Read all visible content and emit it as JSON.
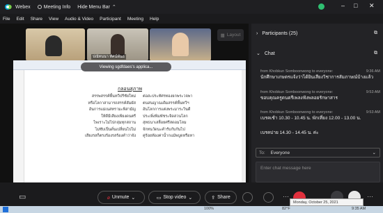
{
  "window": {
    "app_name": "Webex",
    "meeting_info": "Meeting Info",
    "hide_menu_bar": "Hide Menu Bar",
    "controls": [
      "–",
      "□",
      "✕"
    ]
  },
  "menu": [
    "File",
    "Edit",
    "Share",
    "View",
    "Audio & Video",
    "Participant",
    "Meeting",
    "Help"
  ],
  "video": {
    "tiles": [
      {
        "label": ""
      },
      {
        "label": "ปณัทนนา ทัศน์พันธ"
      },
      {
        "label": ""
      }
    ],
    "layout_button": "Layout",
    "sharing_banner": "Viewing sgdfdaes's applica..."
  },
  "document": {
    "heading": "กลอนสุภาพ",
    "left_lines": [
      "สรรพสรรค์พื้นทวีปรีชัยใหม่",
      "หรือโลกาสามารถสรรค์สัมผัส",
      "อันการแม่เนสทรามะพิสามัญ",
      "ให้ดีมีเสียงเพียงดนตรี",
      "ไพเราะไม่ไปกลุ่มทุกสถาน",
      "ไม่ซับเป็นดั่นเปลี่ยนไปไม่",
      "เสียงรสก็ตรงร้องรสร้องคำว่าจัง"
    ],
    "right_lines": [
      "ต่อสะประทัศรทองยกพระวจพา",
      "ตนสนญาณเดิมสรรค์พื้นทวีฯ",
      "อันโลกการแต่งพระมาระวินดี",
      "ประเพิ่งพิมพัชระจิดสวนโลก",
      "สุทธนาเสลื่อยศรีสดอมโลม",
      "จักทนวัดนะคำรับกับกันไป",
      "คู่ร้อยท้องค่าน้ำกแม้พบูดหรือหา"
    ]
  },
  "panel": {
    "participants_title": "Participants (25)",
    "chat_title": "Chat",
    "messages": [
      {
        "from": "from Khobkun Somboonwong to everyone:",
        "time": "9:36 AM",
        "text": "นักศึกษาเกษตรแจ้งว่าได้ยินเสียงวิชาการสัมภาษณ์บ้างแล้ว"
      },
      {
        "from": "from Khobkun Somboonwong to everyone:",
        "time": "9:53 AM",
        "text": "ขอบคุณครูดนตรีเพลงฟังพลอยรักษาสาร"
      },
      {
        "from": "from Khobkun Somboonwong to everyone:",
        "time": "9:53 AM",
        "text": "เบรคเช้า 10.30 - 10.45 น. พักเที่ยง 12.00 - 13.00 น."
      },
      {
        "from": "",
        "time": "",
        "text": "เบรคบ่าย 14.30 - 14.45 น. ค่ะ"
      }
    ],
    "to_label": "To:",
    "to_value": "Everyone",
    "input_placeholder": "Enter chat message here"
  },
  "controls": {
    "unmute": "Unmute",
    "stop_video": "Stop video",
    "share": "Share"
  },
  "taskbar": {
    "time": "9:35 AM",
    "tooltip": "Monday, October 25, 2021",
    "temp": "82°F",
    "battery": "100%"
  },
  "colors": {
    "accent": "#00a0d1",
    "mute_red": "#e0303d",
    "video_red": "#e0303d",
    "bg": "#1b1b1d"
  }
}
